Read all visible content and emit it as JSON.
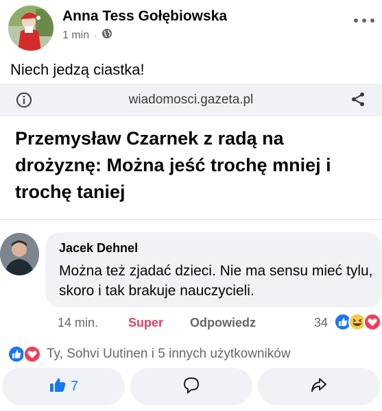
{
  "post": {
    "author": "Anna Tess Gołębiowska",
    "time": "1 min",
    "separator": "·",
    "audience_icon": "globe-icon",
    "text": "Niech jedzą ciastka!"
  },
  "link_preview": {
    "domain": "wiadomosci.gazeta.pl",
    "headline": "Przemysław Czarnek z radą na drożyznę: Można jeść trochę mniej i trochę taniej"
  },
  "comment": {
    "author": "Jacek Dehnel",
    "text": "Można też zjadać dzieci. Nie ma sensu mieć tylu, skoro i tak brakuje nauczycieli.",
    "time": "14 min.",
    "reaction_label": "Super",
    "reply_label": "Odpowiedz",
    "reaction_count": "34",
    "reaction_icons": [
      "like-icon",
      "haha-icon",
      "love-icon"
    ]
  },
  "reactions": {
    "icons": [
      "like-icon",
      "love-icon"
    ],
    "summary": "Ty, Sohvi Uutinen i 5 innych użytkowników"
  },
  "actions": {
    "like_count": "7",
    "like_icon": "thumbs-up-icon",
    "comment_icon": "comment-icon",
    "share_icon": "share-arrow-icon"
  },
  "colors": {
    "accent_blue": "#1877f2",
    "super_red": "#e4405f",
    "secondary_text": "#65676b",
    "bubble_bg": "#f0f2f5"
  }
}
